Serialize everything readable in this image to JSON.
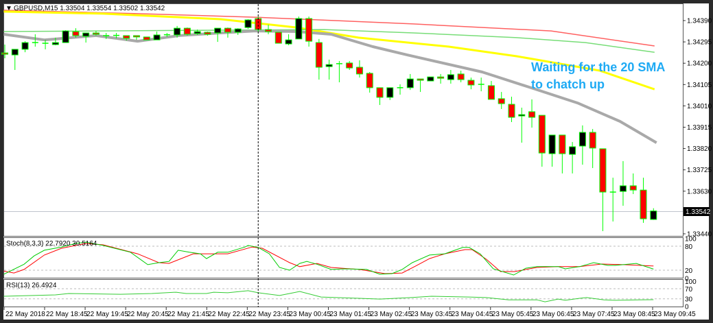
{
  "window": {
    "symbol_info": "GBPUSD,M15  1.33504 1.33554 1.33502 1.33542",
    "menu_glyph": "▼"
  },
  "annotation": {
    "line1": "Waiting for the 20 SMA",
    "line2": "to chatch up"
  },
  "colors": {
    "bull_fill": "#000000",
    "bear_fill": "#ff0000",
    "candle_outline": "#00ff00",
    "sma_20": "#a9a9a9",
    "sma_50": "#77dd77",
    "sma_100": "#ffff00",
    "sma_200": "#ff6060",
    "stoch_main": "#00cc00",
    "stoch_signal": "#ff0000",
    "rsi": "#33cc33",
    "annotation": "#1eaaf4"
  },
  "indicators": {
    "stoch_label": "Stoch(8,3,3) 22.7920 30.5164",
    "rsi_label": "RSI(13) 26.4924",
    "stoch_axis": [
      "100",
      "80",
      "20",
      "0"
    ],
    "rsi_axis": [
      "100",
      "70",
      "30",
      "0"
    ]
  },
  "price_axis": {
    "labels": [
      "1.34390",
      "1.34295",
      "1.34200",
      "1.34105",
      "1.34010",
      "1.33915",
      "1.33820",
      "1.33725",
      "1.33630",
      "1.33440"
    ],
    "current_price": "1.33542"
  },
  "time_axis": [
    "22 May 2018",
    "22 May 18:45",
    "22 May 19:45",
    "22 May 20:45",
    "22 May 21:45",
    "22 May 22:45",
    "22 May 23:45",
    "23 May 00:45",
    "23 May 01:45",
    "23 May 02:45",
    "23 May 03:45",
    "23 May 04:45",
    "23 May 05:45",
    "23 May 06:45",
    "23 May 07:45",
    "23 May 08:45",
    "23 May 09:45"
  ],
  "chart_data": {
    "type": "candlestick",
    "title": "GBPUSD,M15",
    "ylim": [
      1.3342,
      1.3446
    ],
    "crosshair_candle": 26,
    "ohlc": [
      [
        1.34246,
        1.34283,
        1.34222,
        1.3424
      ],
      [
        1.34237,
        1.34262,
        1.3417,
        1.34262
      ],
      [
        1.34262,
        1.34298,
        1.34249,
        1.34292
      ],
      [
        1.34292,
        1.34329,
        1.34274,
        1.34292
      ],
      [
        1.34289,
        1.34304,
        1.34262,
        1.34286
      ],
      [
        1.34283,
        1.34314,
        1.3428,
        1.34292
      ],
      [
        1.34292,
        1.34347,
        1.34292,
        1.34344
      ],
      [
        1.34341,
        1.34356,
        1.34314,
        1.34323
      ],
      [
        1.3432,
        1.34335,
        1.34292,
        1.34335
      ],
      [
        1.34335,
        1.34344,
        1.34323,
        1.34329
      ],
      [
        1.34323,
        1.34335,
        1.34308,
        1.34323
      ],
      [
        1.34323,
        1.34335,
        1.34311,
        1.34324
      ],
      [
        1.34323,
        1.34323,
        1.34301,
        1.34311
      ],
      [
        1.34323,
        1.34323,
        1.34304,
        1.34317
      ],
      [
        1.34317,
        1.34317,
        1.34304,
        1.34304
      ],
      [
        1.34304,
        1.34341,
        1.34304,
        1.34326
      ],
      [
        1.34326,
        1.34335,
        1.34317,
        1.34327
      ],
      [
        1.34326,
        1.34366,
        1.34314,
        1.34356
      ],
      [
        1.34356,
        1.34359,
        1.34323,
        1.34329
      ],
      [
        1.34332,
        1.3435,
        1.34326,
        1.34341
      ],
      [
        1.34338,
        1.34341,
        1.34323,
        1.34329
      ],
      [
        1.34335,
        1.34356,
        1.34295,
        1.34356
      ],
      [
        1.34356,
        1.34359,
        1.34314,
        1.34338
      ],
      [
        1.34338,
        1.34356,
        1.34326,
        1.34353
      ],
      [
        1.34359,
        1.34396,
        1.34353,
        1.34393
      ],
      [
        1.34399,
        1.34408,
        1.34341,
        1.3435
      ],
      [
        1.3435,
        1.34372,
        1.34329,
        1.34341
      ],
      [
        1.34338,
        1.34338,
        1.34289,
        1.34289
      ],
      [
        1.34286,
        1.34329,
        1.3428,
        1.34304
      ],
      [
        1.34308,
        1.34408,
        1.34308,
        1.34399
      ],
      [
        1.34399,
        1.34408,
        1.34274,
        1.34298
      ],
      [
        1.34292,
        1.34308,
        1.34127,
        1.34182
      ],
      [
        1.34185,
        1.34216,
        1.34127,
        1.34194
      ],
      [
        1.34198,
        1.3421,
        1.34115,
        1.34198
      ],
      [
        1.34201,
        1.3421,
        1.3417,
        1.34179
      ],
      [
        1.34182,
        1.34213,
        1.34136,
        1.34152
      ],
      [
        1.34155,
        1.34161,
        1.34069,
        1.34091
      ],
      [
        1.34091,
        1.34091,
        1.34014,
        1.34048
      ],
      [
        1.34048,
        1.34091,
        1.34036,
        1.34091
      ],
      [
        1.34091,
        1.34106,
        1.3406,
        1.3409
      ],
      [
        1.34091,
        1.34152,
        1.34081,
        1.3413
      ],
      [
        1.3413,
        1.3413,
        1.34072,
        1.34124
      ],
      [
        1.34121,
        1.34139,
        1.34121,
        1.34139
      ],
      [
        1.34139,
        1.34152,
        1.34109,
        1.34133
      ],
      [
        1.34127,
        1.3417,
        1.34109,
        1.34149
      ],
      [
        1.34152,
        1.34167,
        1.34115,
        1.34127
      ],
      [
        1.34124,
        1.34136,
        1.34084,
        1.34103
      ],
      [
        1.34106,
        1.34136,
        1.34075,
        1.34106
      ],
      [
        1.341,
        1.34121,
        1.34039,
        1.34039
      ],
      [
        1.34042,
        1.34072,
        1.33996,
        1.3402
      ],
      [
        1.34017,
        1.34051,
        1.33938,
        1.33959
      ],
      [
        1.33965,
        1.34002,
        1.33846,
        1.33971
      ],
      [
        1.33984,
        1.34039,
        1.33913,
        1.33959
      ],
      [
        1.33968,
        1.33968,
        1.33739,
        1.338
      ],
      [
        1.33797,
        1.3388,
        1.33739,
        1.3388
      ],
      [
        1.3388,
        1.3388,
        1.33709,
        1.33797
      ],
      [
        1.33794,
        1.33849,
        1.33709,
        1.33828
      ],
      [
        1.33831,
        1.33923,
        1.33748,
        1.33892
      ],
      [
        1.33892,
        1.33907,
        1.33733,
        1.33822
      ],
      [
        1.33819,
        1.33819,
        1.33452,
        1.33626
      ],
      [
        1.33626,
        1.3369,
        1.33495,
        1.33626
      ],
      [
        1.33629,
        1.33764,
        1.33565,
        1.33654
      ],
      [
        1.33654,
        1.33709,
        1.33617,
        1.33635
      ],
      [
        1.33635,
        1.3369,
        1.33489,
        1.33507
      ],
      [
        1.33504,
        1.33554,
        1.33502,
        1.33542
      ]
    ],
    "moving_averages": [
      {
        "name": "SMA 200",
        "color_key": "sma_200",
        "points": [
          [
            0.9,
            1.34436
          ],
          [
            14.1,
            1.34421
          ],
          [
            25.7,
            1.34405
          ],
          [
            41.3,
            1.34375
          ],
          [
            54.9,
            1.34344
          ],
          [
            65.1,
            1.34277
          ]
        ]
      },
      {
        "name": "SMA 100",
        "color_key": "sma_100",
        "points": [
          [
            0.9,
            1.3443
          ],
          [
            10.7,
            1.34421
          ],
          [
            22.3,
            1.34396
          ],
          [
            29.8,
            1.34359
          ],
          [
            35.9,
            1.34314
          ],
          [
            44.8,
            1.34274
          ],
          [
            51.5,
            1.34231
          ],
          [
            59.7,
            1.34167
          ],
          [
            65.1,
            1.34084
          ]
        ]
      },
      {
        "name": "SMA 50",
        "color_key": "sma_50",
        "points": [
          [
            0.9,
            1.34341
          ],
          [
            21.0,
            1.34347
          ],
          [
            32.5,
            1.3435
          ],
          [
            41.3,
            1.34335
          ],
          [
            51.5,
            1.34314
          ],
          [
            58.3,
            1.34292
          ],
          [
            65.1,
            1.34249
          ]
        ]
      },
      {
        "name": "SMA 20",
        "color_key": "sma_20",
        "points": [
          [
            0.9,
            1.34329
          ],
          [
            4.9,
            1.34304
          ],
          [
            10.0,
            1.34323
          ],
          [
            14.1,
            1.34298
          ],
          [
            18.2,
            1.34323
          ],
          [
            22.3,
            1.34335
          ],
          [
            25.7,
            1.34344
          ],
          [
            29.8,
            1.34341
          ],
          [
            33.2,
            1.34329
          ],
          [
            37.3,
            1.34274
          ],
          [
            40.7,
            1.34237
          ],
          [
            48.1,
            1.34161
          ],
          [
            52.9,
            1.34091
          ],
          [
            57.5,
            1.34023
          ],
          [
            61.7,
            1.33941
          ],
          [
            65.3,
            1.33846
          ]
        ]
      }
    ],
    "stochastic": {
      "main": [
        [
          0.9,
          10
        ],
        [
          2.9,
          35
        ],
        [
          3.9,
          56
        ],
        [
          4.9,
          70
        ],
        [
          6.6,
          78
        ],
        [
          8.0,
          87
        ],
        [
          9.0,
          90
        ],
        [
          10.7,
          82
        ],
        [
          13.4,
          65
        ],
        [
          15.1,
          34
        ],
        [
          16.2,
          39
        ],
        [
          17.2,
          42
        ],
        [
          18.1,
          70
        ],
        [
          19.2,
          65
        ],
        [
          20.3,
          61
        ],
        [
          20.9,
          49
        ],
        [
          22.0,
          65
        ],
        [
          23.0,
          65
        ],
        [
          24.7,
          78
        ],
        [
          25.0,
          82
        ],
        [
          26.0,
          77
        ],
        [
          27.1,
          61
        ],
        [
          28.1,
          27
        ],
        [
          29.1,
          20
        ],
        [
          30.1,
          37
        ],
        [
          30.8,
          42
        ],
        [
          31.8,
          35
        ],
        [
          33.2,
          22
        ],
        [
          34.5,
          23.5
        ],
        [
          36.7,
          22
        ],
        [
          38.0,
          10
        ],
        [
          39.2,
          11.5
        ],
        [
          40.2,
          22
        ],
        [
          41.2,
          39
        ],
        [
          42.9,
          58
        ],
        [
          44.4,
          61
        ],
        [
          45.4,
          70
        ],
        [
          46.2,
          77
        ],
        [
          46.8,
          77
        ],
        [
          47.9,
          61
        ],
        [
          49.2,
          23.5
        ],
        [
          51.2,
          8
        ],
        [
          52.4,
          25
        ],
        [
          53.5,
          29
        ],
        [
          55.6,
          29
        ],
        [
          56.3,
          23.5
        ],
        [
          57.7,
          29
        ],
        [
          59.1,
          39
        ],
        [
          60.5,
          32
        ],
        [
          61.2,
          32
        ],
        [
          63.3,
          37
        ],
        [
          65.0,
          22.79
        ]
      ],
      "signal": [
        [
          0.9,
          18
        ],
        [
          1.9,
          13
        ],
        [
          2.9,
          22
        ],
        [
          4.9,
          58
        ],
        [
          6.6,
          75
        ],
        [
          9.0,
          87
        ],
        [
          10.7,
          83.5
        ],
        [
          14.1,
          61
        ],
        [
          16.2,
          39
        ],
        [
          17.2,
          37
        ],
        [
          19.6,
          61
        ],
        [
          20.9,
          61
        ],
        [
          23.0,
          61
        ],
        [
          25.4,
          78
        ],
        [
          26.4,
          75
        ],
        [
          29.1,
          39
        ],
        [
          30.1,
          29
        ],
        [
          31.8,
          37
        ],
        [
          33.2,
          27
        ],
        [
          36.0,
          22
        ],
        [
          38.5,
          11.5
        ],
        [
          40.2,
          13
        ],
        [
          41.5,
          30
        ],
        [
          42.9,
          49
        ],
        [
          44.4,
          61
        ],
        [
          46.4,
          71.5
        ],
        [
          47.1,
          71.5
        ],
        [
          48.5,
          47.5
        ],
        [
          49.9,
          16.6
        ],
        [
          51.3,
          16.6
        ],
        [
          53.5,
          27
        ],
        [
          55.6,
          29
        ],
        [
          57.7,
          29
        ],
        [
          59.9,
          35.5
        ],
        [
          62.0,
          34
        ],
        [
          65.0,
          30.52
        ]
      ],
      "levels": [
        80,
        20
      ]
    },
    "rsi": {
      "values": [
        [
          0.9,
          40
        ],
        [
          6.0,
          45.5
        ],
        [
          7.3,
          51
        ],
        [
          12.4,
          48
        ],
        [
          15.5,
          51
        ],
        [
          17.9,
          56
        ],
        [
          18.9,
          51
        ],
        [
          20.9,
          51
        ],
        [
          21.6,
          56
        ],
        [
          23.0,
          54
        ],
        [
          25.0,
          62
        ],
        [
          26.0,
          54
        ],
        [
          28.1,
          43
        ],
        [
          29.1,
          51
        ],
        [
          30.1,
          59
        ],
        [
          32.2,
          37
        ],
        [
          36.0,
          32
        ],
        [
          38.0,
          29
        ],
        [
          41.1,
          35
        ],
        [
          43.1,
          40
        ],
        [
          46.8,
          37
        ],
        [
          48.5,
          35
        ],
        [
          50.7,
          26
        ],
        [
          53.5,
          26
        ],
        [
          54.3,
          18
        ],
        [
          55.6,
          29
        ],
        [
          56.3,
          24
        ],
        [
          57.7,
          32
        ],
        [
          58.4,
          35
        ],
        [
          60.1,
          26
        ],
        [
          61.2,
          24
        ],
        [
          63.6,
          26
        ],
        [
          65.0,
          26.49
        ]
      ],
      "levels": [
        70,
        30
      ]
    }
  }
}
